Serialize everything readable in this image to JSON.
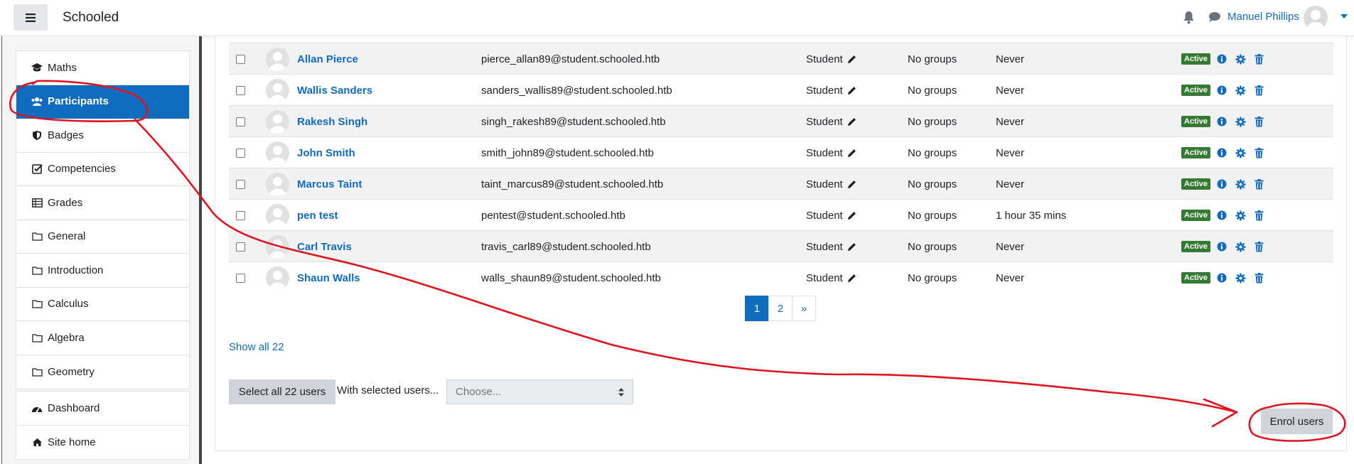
{
  "header": {
    "brand": "Schooled",
    "user_name": "Manuel Phillips",
    "icons": [
      "menu-icon",
      "bell-icon",
      "chat-icon",
      "user-avatar",
      "caret-down-icon"
    ]
  },
  "sidebar": {
    "course_items": [
      {
        "label": "Maths",
        "icon": "graduation-cap-icon",
        "active": false
      },
      {
        "label": "Participants",
        "icon": "users-icon",
        "active": true
      },
      {
        "label": "Badges",
        "icon": "shield-icon",
        "active": false
      },
      {
        "label": "Competencies",
        "icon": "checkbox-icon",
        "active": false
      },
      {
        "label": "Grades",
        "icon": "table-icon",
        "active": false
      },
      {
        "label": "General",
        "icon": "folder-icon",
        "active": false
      },
      {
        "label": "Introduction",
        "icon": "folder-icon",
        "active": false
      },
      {
        "label": "Calculus",
        "icon": "folder-icon",
        "active": false
      },
      {
        "label": "Algebra",
        "icon": "folder-icon",
        "active": false
      },
      {
        "label": "Geometry",
        "icon": "folder-icon",
        "active": false
      }
    ],
    "site_items": [
      {
        "label": "Dashboard",
        "icon": "dashboard-icon"
      },
      {
        "label": "Site home",
        "icon": "home-icon"
      }
    ]
  },
  "participants": [
    {
      "name": "Allan Pierce",
      "email": "pierce_allan89@student.schooled.htb",
      "role": "Student",
      "groups": "No groups",
      "last_access": "Never",
      "status": "Active"
    },
    {
      "name": "Wallis Sanders",
      "email": "sanders_wallis89@student.schooled.htb",
      "role": "Student",
      "groups": "No groups",
      "last_access": "Never",
      "status": "Active"
    },
    {
      "name": "Rakesh Singh",
      "email": "singh_rakesh89@student.schooled.htb",
      "role": "Student",
      "groups": "No groups",
      "last_access": "Never",
      "status": "Active"
    },
    {
      "name": "John Smith",
      "email": "smith_john89@student.schooled.htb",
      "role": "Student",
      "groups": "No groups",
      "last_access": "Never",
      "status": "Active"
    },
    {
      "name": "Marcus Taint",
      "email": "taint_marcus89@student.schooled.htb",
      "role": "Student",
      "groups": "No groups",
      "last_access": "Never",
      "status": "Active"
    },
    {
      "name": "pen test",
      "email": "pentest@student.schooled.htb",
      "role": "Student",
      "groups": "No groups",
      "last_access": "1 hour 35 mins",
      "status": "Active"
    },
    {
      "name": "Carl Travis",
      "email": "travis_carl89@student.schooled.htb",
      "role": "Student",
      "groups": "No groups",
      "last_access": "Never",
      "status": "Active"
    },
    {
      "name": "Shaun Walls",
      "email": "walls_shaun89@student.schooled.htb",
      "role": "Student",
      "groups": "No groups",
      "last_access": "Never",
      "status": "Active"
    }
  ],
  "pagination": {
    "pages": [
      "1",
      "2",
      "»"
    ],
    "current": "1"
  },
  "footer": {
    "show_all": "Show all 22",
    "select_all": "Select all 22 users",
    "with_selected": "With selected users...",
    "choose_placeholder": "Choose...",
    "enrol": "Enrol users"
  },
  "colors": {
    "accent": "#0f6cbf",
    "active_badge": "#357a32",
    "annotation": "#e0141e"
  }
}
